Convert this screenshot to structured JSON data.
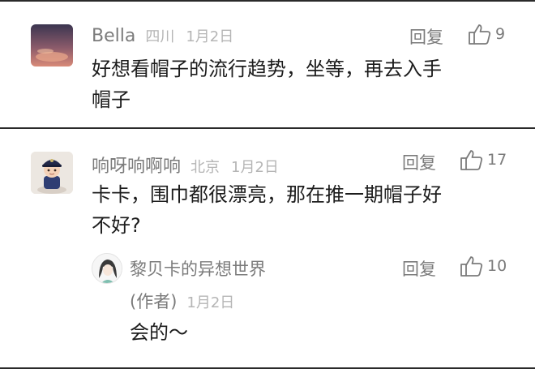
{
  "comments": [
    {
      "author": "Bella",
      "location": "四川",
      "date": "1月2日",
      "reply_label": "回复",
      "likes": "9",
      "text_lines": [
        "好想看帽子的流行趋势，坐等，再去入手",
        "帽子"
      ]
    },
    {
      "author": "响呀响啊响",
      "location": "北京",
      "date": "1月2日",
      "reply_label": "回复",
      "likes": "17",
      "text_lines": [
        "卡卡，围巾都很漂亮，那在推一期帽子好",
        "不好?"
      ],
      "reply": {
        "author": "黎贝卡的异想世界",
        "author_tag": "(作者)",
        "date": "1月2日",
        "reply_label": "回复",
        "likes": "10",
        "text": "会的～"
      }
    }
  ],
  "icons": {
    "like": "thumbs-up-outline-icon"
  },
  "colors": {
    "meta": "#7b7b7b",
    "muted": "#b5b5b5",
    "text": "#1c1c1c",
    "divider": "#2a2a2a"
  }
}
